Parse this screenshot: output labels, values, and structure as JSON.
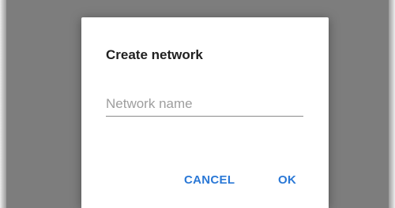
{
  "dialog": {
    "title": "Create network",
    "name_input": {
      "value": "",
      "placeholder": "Network name"
    },
    "cancel_label": "CANCEL",
    "ok_label": "OK"
  },
  "colors": {
    "accent": "#2a78d6",
    "scrim": "#7d7d7d",
    "dialog_bg": "#ffffff",
    "title_text": "#212121",
    "placeholder_text": "#9e9e9e"
  }
}
